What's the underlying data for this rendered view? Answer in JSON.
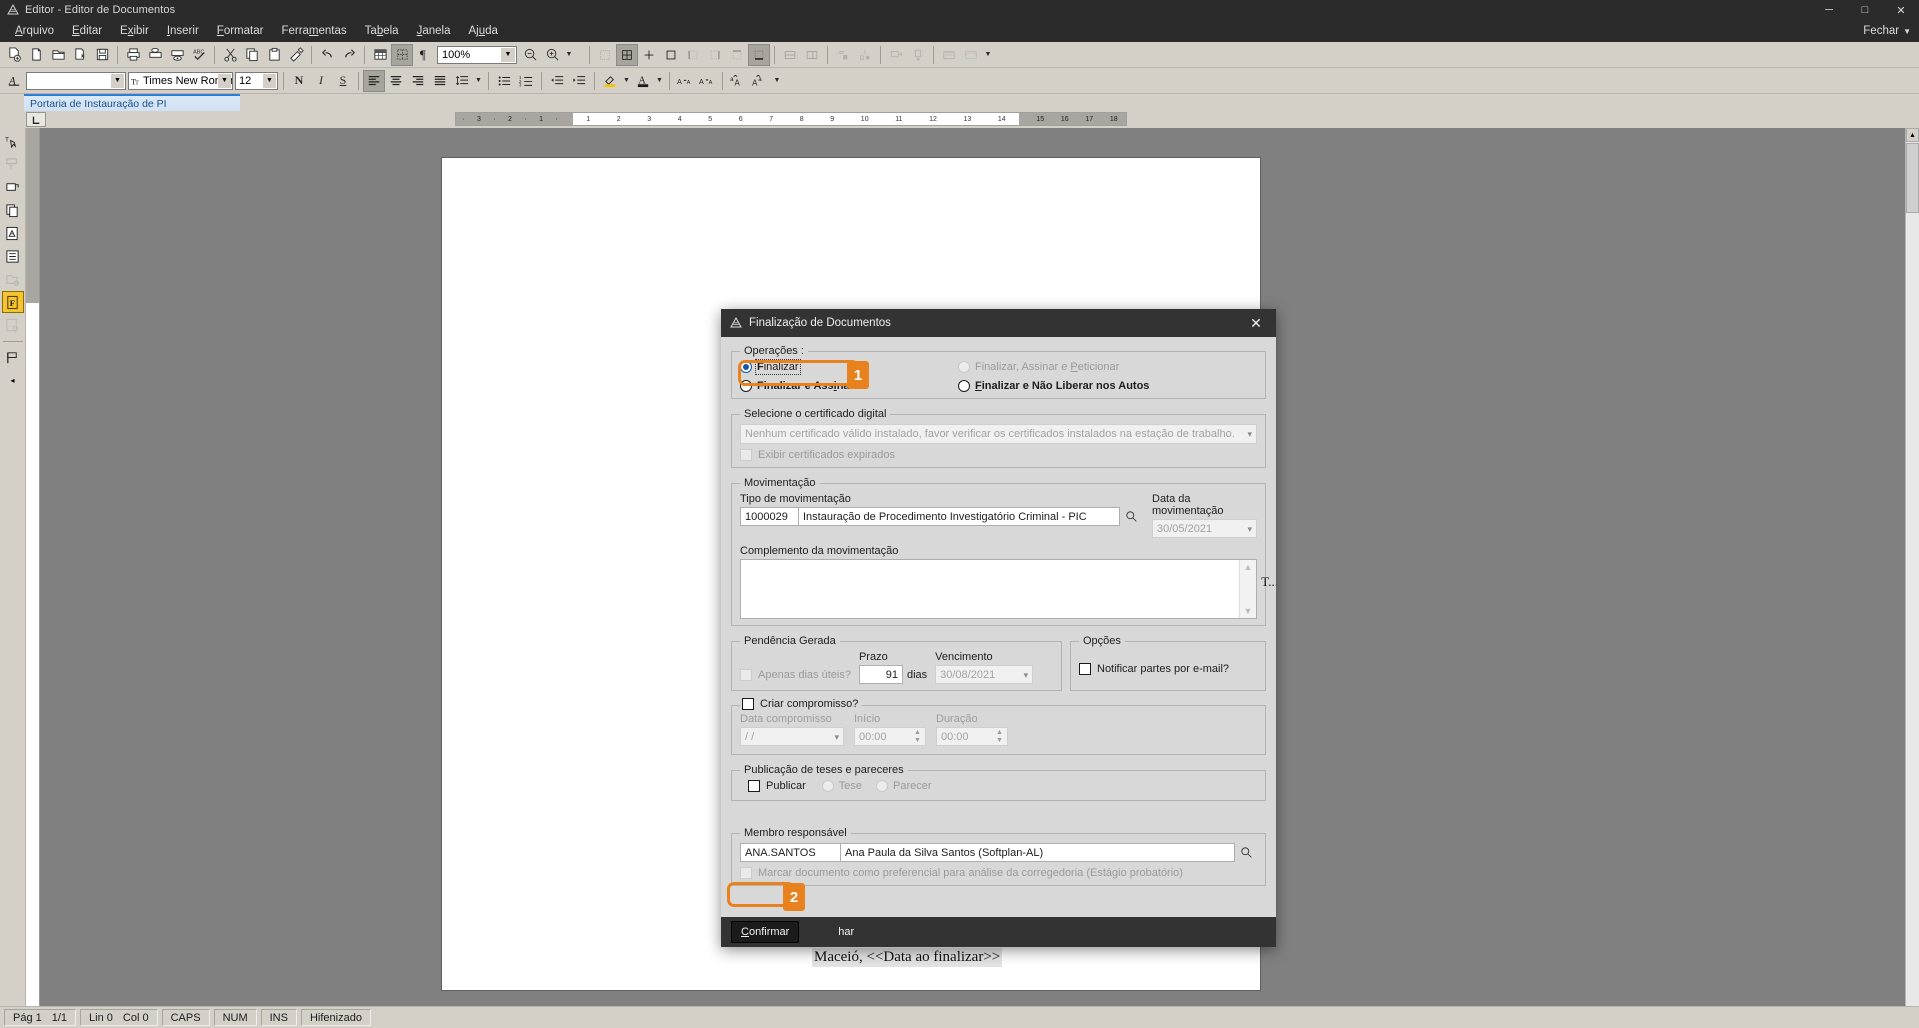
{
  "window": {
    "title": "Editor - Editor de Documentos",
    "app_icon": "editor-icon",
    "minimize": "─",
    "maximize": "□",
    "close": "✕"
  },
  "menu": {
    "items": [
      {
        "label": "Arquivo",
        "accel": "A"
      },
      {
        "label": "Editar",
        "accel": "E"
      },
      {
        "label": "Exibir",
        "accel": "x"
      },
      {
        "label": "Inserir",
        "accel": "I"
      },
      {
        "label": "Formatar",
        "accel": "F"
      },
      {
        "label": "Ferramentas",
        "accel": "m"
      },
      {
        "label": "Tabela",
        "accel": "b"
      },
      {
        "label": "Janela",
        "accel": "J"
      },
      {
        "label": "Ajuda",
        "accel": "u"
      }
    ],
    "close_label": "Fechar",
    "close_caret": "▼"
  },
  "toolbar_main": {
    "zoom_value": "100%",
    "buttons": [
      "new-document-icon",
      "blank-page-icon",
      "open-folder-icon",
      "open-template-icon",
      "save-icon",
      "print-icon",
      "print-preview-icon",
      "print-setup-icon",
      "spellcheck-icon",
      "cut-icon",
      "copy-icon",
      "paste-icon",
      "format-painter-icon",
      "undo-icon",
      "redo-icon",
      "insert-table-icon",
      "table-properties-icon",
      "paragraph-marks-icon"
    ],
    "zoom_out": "zoom-out-icon",
    "zoom_in": "zoom-in-icon",
    "overflow": "toolbar-overflow-icon"
  },
  "toolbar_table": {
    "buttons": [
      "table-grid-icon",
      "table-all-borders-icon",
      "table-inside-borders-icon",
      "table-outside-box-icon",
      "table-left-border-icon",
      "table-right-border-icon",
      "table-top-border-icon",
      "table-bottom-border-icon",
      "merge-cells-icon",
      "split-cells-icon",
      "insert-row-icon",
      "insert-column-icon",
      "distribute-rows-icon",
      "distribute-columns-icon",
      "table-shading-icon",
      "table-autoformat-icon"
    ],
    "overflow": "toolbar-overflow-icon"
  },
  "toolbar_format": {
    "style_value": "",
    "font_value": "Times New Romar",
    "size_value": "12",
    "bold": "N",
    "italic": "I",
    "underline": "S",
    "buttons": [
      "align-left-icon",
      "align-center-icon",
      "align-right-icon",
      "align-justify-icon",
      "line-spacing-icon",
      "bullets-icon",
      "numbering-icon",
      "decrease-indent-icon",
      "increase-indent-icon",
      "highlight-color-icon",
      "font-color-icon",
      "increase-font-icon",
      "decrease-font-icon",
      "uppercase-icon",
      "lowercase-icon"
    ]
  },
  "vertical_toolbar": {
    "buttons": [
      "text-select-icon",
      "text-field-icon",
      "insert-object-icon",
      "copy-block-icon",
      "warning-doc-icon",
      "list-doc-icon",
      "folder-doc-icon",
      "flag-doc-icon",
      "seal-doc-icon",
      "tag-icon"
    ],
    "collapse": "◂"
  },
  "tab": {
    "label": "Portaria de Instauração de PI"
  },
  "ruler": {
    "tab_selector": "tab-stop-left-icon",
    "left_labels": [
      "3",
      "2",
      "1"
    ],
    "right_labels": [
      "1",
      "2",
      "3",
      "4",
      "5",
      "6",
      "7",
      "8",
      "9",
      "10",
      "11",
      "12",
      "13",
      "14",
      "15",
      "16",
      "17",
      "18"
    ]
  },
  "document": {
    "body_text": "Maceió, <<Data ao finalizar>>"
  },
  "statusbar": {
    "page": "Pág 1",
    "pages": "1/1",
    "line": "Lin 0",
    "col": "Col 0",
    "caps": "CAPS",
    "num": "NUM",
    "ins": "INS",
    "hyphen": "Hifenizado"
  },
  "dialog": {
    "title": "Finalização de Documentos",
    "title_icon": "finalize-doc-icon",
    "close_icon": "✕",
    "operations": {
      "legend": "Operações :",
      "options": [
        {
          "label": "Finalizar",
          "accel_prefix": "",
          "selected": true,
          "disabled": false,
          "focused": true
        },
        {
          "label": "Finalizar e Assinar",
          "selected": false,
          "disabled": false,
          "focused": false
        },
        {
          "label": "Finalizar, Assinar e Peticionar",
          "selected": false,
          "disabled": true,
          "focused": false
        },
        {
          "label": "Finalizar e Não Liberar nos Autos",
          "selected": false,
          "disabled": false,
          "focused": false
        }
      ]
    },
    "certificate": {
      "legend": "Selecione o certificado digital",
      "select_value": "Nenhum certificado válido instalado, favor verificar os certificados instalados na estação de trabalho.",
      "expired_checkbox": "Exibir certificados expirados"
    },
    "movement": {
      "legend": "Movimentação",
      "type_label": "Tipo de movimentação",
      "code_value": "1000029",
      "desc_value": "Instauração de Procedimento Investigatório Criminal - PIC",
      "search_icon": "search-icon",
      "date_label": "Data da movimentação",
      "date_value": "30/05/2021",
      "complement_label": "Complemento da movimentação",
      "complement_value": "",
      "complement_marker": "T..."
    },
    "pendency": {
      "legend": "Pendência Gerada",
      "business_days_label": "Apenas dias úteis?",
      "deadline_label": "Prazo",
      "deadline_value": "91",
      "days_suffix": "dias",
      "due_label": "Vencimento",
      "due_value": "30/08/2021"
    },
    "options_group": {
      "legend": "Opções",
      "notify_label": "Notificar partes por e-mail?"
    },
    "appointment": {
      "checkbox_label": "Criar compromisso?",
      "date_label": "Data compromisso",
      "date_value": "/ /",
      "start_label": "Início",
      "start_value": "00:00",
      "duration_label": "Duração",
      "duration_value": "00:00"
    },
    "publication": {
      "legend": "Publicação de teses e pareceres",
      "publish_label": "Publicar",
      "thesis_label": "Tese",
      "opinion_label": "Parecer"
    },
    "member": {
      "legend": "Membro responsável",
      "code_value": "ANA.SANTOS",
      "name_value": "Ana Paula da Silva Santos (Softplan-AL)",
      "search_icon": "search-icon",
      "preferential_label": "Marcar documento como preferencial para análise da corregedoria (Estágio probatório)"
    },
    "footer": {
      "confirm": "Confirmar",
      "close": "har"
    }
  },
  "callouts": [
    {
      "number": "1",
      "target": "finalizar-e-assinar-radio"
    },
    {
      "number": "2",
      "target": "confirmar-button"
    }
  ],
  "colors": {
    "accent": "#e8821e",
    "dialog_header": "#333333",
    "titlebar": "#2b2b2b",
    "toolbar": "#d4d0c8",
    "canvas": "#808080",
    "tab_accent": "#2a7fd4"
  }
}
